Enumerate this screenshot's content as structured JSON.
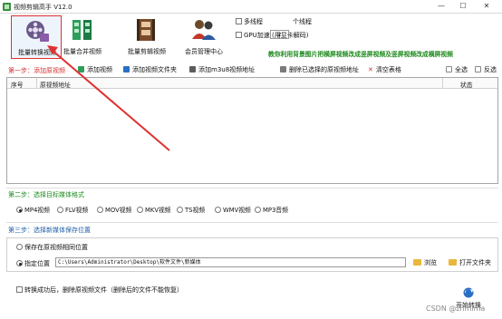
{
  "window": {
    "title": "视频剪辑高手 V12.0",
    "minimize": "—",
    "maximize": "☐",
    "close": "✕"
  },
  "toolbar": {
    "items": [
      {
        "label": "批量转换视频",
        "icon": "film-reel-icon",
        "selected": true
      },
      {
        "label": "批量合并视频",
        "icon": "film-merge-icon",
        "selected": false
      },
      {
        "label": "批量剪辑视频",
        "icon": "film-cut-icon",
        "selected": false
      },
      {
        "label": "会员管理中心",
        "icon": "users-icon",
        "selected": false
      }
    ]
  },
  "options": {
    "multithread_label": "多线程",
    "thread_count": "2",
    "thread_unit": "个线程",
    "gpu_label": "GPU加速 (用显卡解码)",
    "notice": "教你利用背景图片把横屏视频改成竖屏视频及竖屏视频改成横屏视频"
  },
  "step1": {
    "label": "第一步：添加原视频",
    "actions": {
      "add_video": "添加视频",
      "add_folder": "添加视频文件夹",
      "add_m3u8": "添加m3u8视频地址",
      "delete_selected": "删除已选择的原视频地址",
      "clear_table": "清空表格",
      "select_all": "全选",
      "invert": "反选"
    },
    "table": {
      "headers": [
        "序号",
        "原视频地址",
        "状态"
      ],
      "rows": []
    }
  },
  "step2": {
    "label": "第二步：选择目标媒体格式",
    "formats": [
      "MP4视频",
      "FLV视频",
      "MOV视频",
      "MKV视频",
      "TS视频",
      "WMV视频",
      "MP3音频"
    ],
    "selected_format": "MP4视频"
  },
  "step3": {
    "label": "第三步：选择新媒体保存位置",
    "same_location": "保存在原视频相同位置",
    "custom_location": "指定位置",
    "path": "C:\\Users\\Administrator\\Desktop\\软件文件\\新媒体",
    "browse": "浏览",
    "open_folder": "打开文件夹"
  },
  "footer": {
    "delete_after": "转换成功后，删除原视频文件（删除后的文件不能恢复）",
    "start": "开始转换",
    "watermark": "CSDN @zhmima"
  },
  "colors": {
    "step_red": "#d32f2f",
    "step_green": "#1b8a1b",
    "step_blue": "#1e5fa8",
    "annotation_red": "#e03131"
  }
}
